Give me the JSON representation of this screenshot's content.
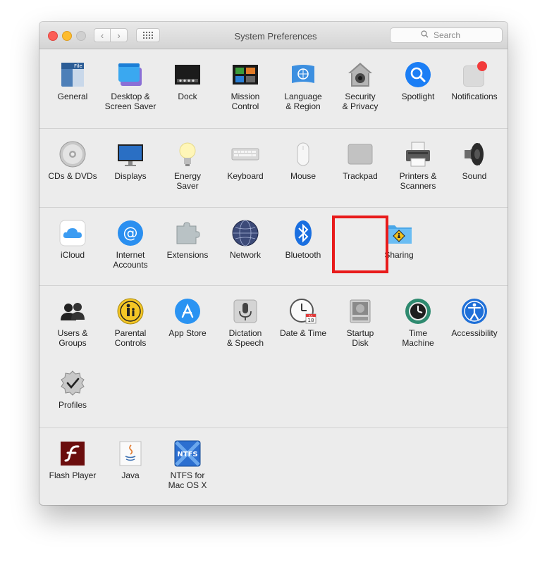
{
  "window": {
    "title": "System Preferences",
    "search_placeholder": "Search",
    "nav_back_glyph": "‹",
    "nav_forward_glyph": "›"
  },
  "sections": [
    {
      "panes": [
        {
          "label": "General",
          "icon": "general-icon"
        },
        {
          "label": "Desktop &\nScreen Saver",
          "icon": "desktop-icon"
        },
        {
          "label": "Dock",
          "icon": "dock-icon"
        },
        {
          "label": "Mission\nControl",
          "icon": "mission-control-icon"
        },
        {
          "label": "Language\n& Region",
          "icon": "language-icon"
        },
        {
          "label": "Security\n& Privacy",
          "icon": "security-icon"
        },
        {
          "label": "Spotlight",
          "icon": "spotlight-icon"
        },
        {
          "label": "Notifications",
          "icon": "notifications-icon"
        }
      ]
    },
    {
      "panes": [
        {
          "label": "CDs & DVDs",
          "icon": "cd-icon"
        },
        {
          "label": "Displays",
          "icon": "display-icon"
        },
        {
          "label": "Energy\nSaver",
          "icon": "lightbulb-icon"
        },
        {
          "label": "Keyboard",
          "icon": "keyboard-icon"
        },
        {
          "label": "Mouse",
          "icon": "mouse-icon"
        },
        {
          "label": "Trackpad",
          "icon": "trackpad-icon"
        },
        {
          "label": "Printers &\nScanners",
          "icon": "printer-icon"
        },
        {
          "label": "Sound",
          "icon": "speaker-icon"
        }
      ]
    },
    {
      "panes": [
        {
          "label": "iCloud",
          "icon": "cloud-icon"
        },
        {
          "label": "Internet\nAccounts",
          "icon": "at-sign-icon"
        },
        {
          "label": "Extensions",
          "icon": "puzzle-icon"
        },
        {
          "label": "Network",
          "icon": "globe-icon"
        },
        {
          "label": "Bluetooth",
          "icon": "bluetooth-icon"
        },
        {
          "label": "Sharing",
          "icon": "sharing-folder-icon",
          "highlighted": true
        }
      ]
    },
    {
      "panes": [
        {
          "label": "Users &\nGroups",
          "icon": "users-icon"
        },
        {
          "label": "Parental\nControls",
          "icon": "parental-icon"
        },
        {
          "label": "App Store",
          "icon": "app-store-icon"
        },
        {
          "label": "Dictation\n& Speech",
          "icon": "microphone-icon"
        },
        {
          "label": "Date & Time",
          "icon": "clock-calendar-icon",
          "calendar_day": "18",
          "calendar_month": "JUL"
        },
        {
          "label": "Startup\nDisk",
          "icon": "disk-icon"
        },
        {
          "label": "Time\nMachine",
          "icon": "time-machine-icon"
        },
        {
          "label": "Accessibility",
          "icon": "accessibility-icon"
        },
        {
          "label": "Profiles",
          "icon": "profiles-badge-icon"
        }
      ]
    },
    {
      "panes": [
        {
          "label": "Flash Player",
          "icon": "flash-icon"
        },
        {
          "label": "Java",
          "icon": "java-icon"
        },
        {
          "label": "NTFS for\nMac OS X",
          "icon": "ntfs-icon",
          "icon_text": "NTFS"
        }
      ]
    }
  ],
  "colors": {
    "highlight": "#e81b1b",
    "close": "#fc5e57",
    "minimize": "#fdbc2e",
    "zoom": "#d0d0d0",
    "accent_blue": "#1b7ef5"
  }
}
